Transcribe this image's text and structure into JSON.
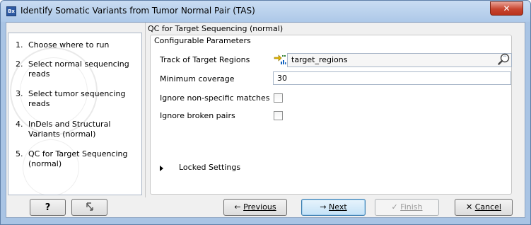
{
  "window": {
    "title": "Identify Somatic Variants from Tumor Normal Pair (TAS)",
    "app_icon_text": "Bx",
    "close_glyph": "✕"
  },
  "steps": [
    {
      "num": "1.",
      "label": "Choose where to run"
    },
    {
      "num": "2.",
      "label": "Select normal sequencing reads"
    },
    {
      "num": "3.",
      "label": "Select tumor sequencing reads"
    },
    {
      "num": "4.",
      "label": "InDels and Structural Variants (normal)"
    },
    {
      "num": "5.",
      "label": "QC for Target Sequencing (normal)"
    }
  ],
  "panel": {
    "heading": "QC for Target Sequencing (normal)",
    "group_title": "Configurable Parameters",
    "track_label": "Track of Target Regions",
    "track_value": "target_regions",
    "coverage_label": "Minimum coverage",
    "coverage_value": "30",
    "ignore_nonspecific_label": "Ignore non-specific matches",
    "ignore_nonspecific_checked": false,
    "ignore_broken_label": "Ignore broken pairs",
    "ignore_broken_checked": false,
    "locked_label": "Locked Settings"
  },
  "buttons": {
    "help": "?",
    "reset_icon": "reset-icon",
    "previous_arrow": "←",
    "previous_text": "Previous",
    "next_arrow": "→",
    "next_text": "Next",
    "finish_check": "✓",
    "finish_text": "Finish",
    "cancel_x": "✕",
    "cancel_text": "Cancel"
  },
  "colors": {
    "title_bar": "#adc8e8",
    "close_button": "#c8452f",
    "primary_button": "#c4e2f7"
  }
}
